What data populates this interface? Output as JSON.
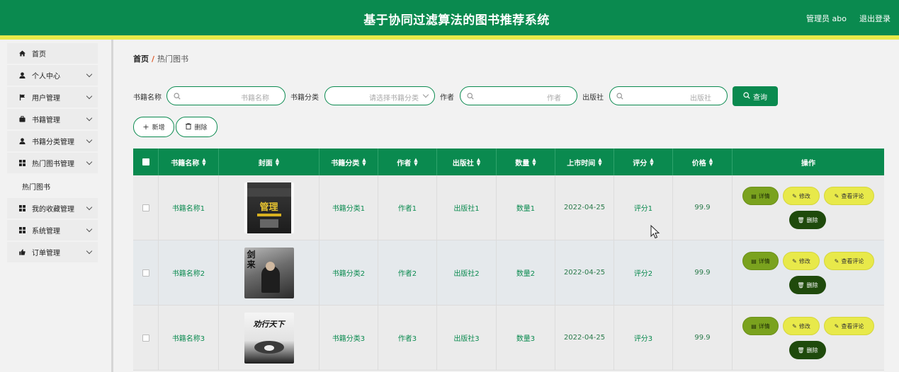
{
  "header": {
    "title": "基于协同过滤算法的图书推荐系统",
    "user": "管理员 abo",
    "logout": "退出登录"
  },
  "sidebar": {
    "items": [
      {
        "label": "首页",
        "icon": "home-icon",
        "expandable": false
      },
      {
        "label": "个人中心",
        "icon": "user-icon",
        "expandable": true
      },
      {
        "label": "用户管理",
        "icon": "flag-icon",
        "expandable": true
      },
      {
        "label": "书籍管理",
        "icon": "briefcase-icon",
        "expandable": true
      },
      {
        "label": "书籍分类管理",
        "icon": "user-icon",
        "expandable": true
      },
      {
        "label": "热门图书管理",
        "icon": "grid-icon",
        "expandable": true
      },
      {
        "label": "热门图书",
        "icon": "",
        "expandable": false,
        "child": true
      },
      {
        "label": "我的收藏管理",
        "icon": "grid-icon",
        "expandable": true
      },
      {
        "label": "系统管理",
        "icon": "grid-icon",
        "expandable": true
      },
      {
        "label": "订单管理",
        "icon": "thumbs-up-icon",
        "expandable": true
      }
    ]
  },
  "breadcrumb": {
    "home": "首页",
    "separator": "/",
    "current": "热门图书"
  },
  "filters": {
    "book_name": {
      "label": "书籍名称",
      "placeholder": "书籍名称"
    },
    "category": {
      "label": "书籍分类",
      "placeholder": "请选择书籍分类"
    },
    "author": {
      "label": "作者",
      "placeholder": "作者"
    },
    "publisher": {
      "label": "出版社",
      "placeholder": "出版社"
    },
    "search_label": "查询"
  },
  "toolbar": {
    "add_label": "新增",
    "delete_label": "删除"
  },
  "table": {
    "columns": [
      "书籍名称",
      "封面",
      "书籍分类",
      "作者",
      "出版社",
      "数量",
      "上市时间",
      "评分",
      "价格",
      "操作"
    ],
    "rows": [
      {
        "name": "书籍名称1",
        "cover_title": "管理",
        "category": "书籍分类1",
        "author": "作者1",
        "publisher": "出版社1",
        "quantity": "数量1",
        "date": "2022-04-25",
        "rating": "评分1",
        "price": "99.9"
      },
      {
        "name": "书籍名称2",
        "cover_title": "剑来",
        "category": "书籍分类2",
        "author": "作者2",
        "publisher": "出版社2",
        "quantity": "数量2",
        "date": "2022-04-25",
        "rating": "评分2",
        "price": "99.9"
      },
      {
        "name": "书籍名称3",
        "cover_title": "劝行天下",
        "category": "书籍分类3",
        "author": "作者3",
        "publisher": "出版社3",
        "quantity": "数量3",
        "date": "2022-04-25",
        "rating": "评分3",
        "price": "99.9"
      }
    ],
    "actions": {
      "detail": "详情",
      "edit": "修改",
      "review": "查看评论",
      "delete": "删除"
    }
  },
  "colors": {
    "primary": "#0a8a4f",
    "accent": "#e8e94a",
    "detail": "#7aa21e",
    "danger": "#1f4a0c"
  }
}
